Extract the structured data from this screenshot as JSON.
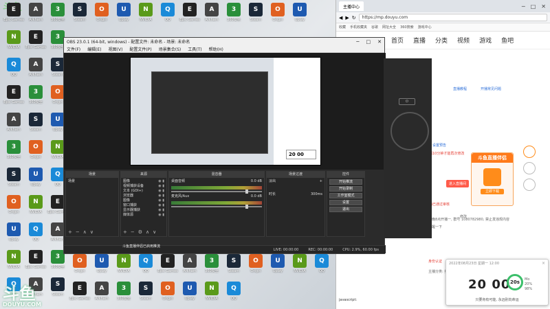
{
  "desktop": {
    "watermark": "斗鱼",
    "watermark_sub": "DOUYU.COM",
    "top_watermark": "斗鱼",
    "icons": [
      {
        "label": "Epic Games",
        "color": "#222",
        "glyph": "E"
      },
      {
        "label": "Arkham",
        "color": "#444",
        "glyph": "A"
      },
      {
        "label": "360安全",
        "color": "#2a8f3a",
        "glyph": "3"
      },
      {
        "label": "Steam",
        "color": "#1b2838",
        "glyph": "S"
      },
      {
        "label": "Origin",
        "color": "#e06020",
        "glyph": "O"
      },
      {
        "label": "Uplay",
        "color": "#1e5ab0",
        "glyph": "U"
      },
      {
        "label": "NVIDIA",
        "color": "#5a9a1a",
        "glyph": "N"
      },
      {
        "label": "QQ",
        "color": "#1a8ad8",
        "glyph": "Q"
      }
    ]
  },
  "obs": {
    "title": "OBS 23.0.1 (64-bit, windows) - 配置文件: 未命名 - 场景: 未命名",
    "menu": [
      "文件(F)",
      "编辑(E)",
      "视图(V)",
      "配置文件(P)",
      "场景集合(S)",
      "工具(T)",
      "帮助(H)"
    ],
    "docks": {
      "scenes": {
        "title": "场景",
        "items": [
          "场景"
        ]
      },
      "sources": {
        "title": "来源",
        "items": [
          "图像",
          "视频捕获设备",
          "文本 (GDI+)",
          "浏览器",
          "图像",
          "窗口捕获",
          "显示器捕获",
          "媒体源"
        ]
      },
      "mixer": {
        "title": "混音器",
        "tracks": [
          {
            "name": "桌面音频",
            "db": "0.0 dB"
          },
          {
            "name": "麦克风/Aux",
            "db": "0.0 dB"
          }
        ]
      },
      "transitions": {
        "title": "场景过渡",
        "type": "淡出",
        "duration_label": "时长",
        "duration_value": "300ms"
      },
      "controls": {
        "title": "控件",
        "buttons": [
          "开始推流",
          "开始录制",
          "工作室模式",
          "设置",
          "退出"
        ]
      }
    },
    "status": [
      "LIVE: 00:00:00",
      "REC: 00:00:00",
      "CPU: 2.9%, 60.00 fps"
    ],
    "notice": "斗鱼直播伴侣已启用推流"
  },
  "browser": {
    "tab_title": "主播中心",
    "url": "https://mp.douyu.com",
    "bookmarks": [
      "收藏",
      "手机收藏夹",
      "谷歌",
      "网址大全",
      "360搜索",
      "游戏中心"
    ],
    "nav": [
      "首页",
      "直播",
      "分类",
      "视频",
      "游戏",
      "鱼吧"
    ],
    "promo_title": "斗鱼直播伴侣",
    "promo_btn": "立即下载",
    "links": [
      "直播教程",
      "开播常见问题",
      "设置预告",
      "修改"
    ],
    "red_notes": [
      "需要间隔10分钟才能再次修改",
      "身份认证",
      "直播已通过审核"
    ],
    "grey_notes": [
      "每晚8点开播一, 群号 1080782980, 禁止发违规内容",
      "提醒一下",
      "主播分类: 英雄联盟"
    ],
    "orange_btn": "进入直播间",
    "bottom_input": "javascript:"
  },
  "timer": {
    "head": "2022年08月23日 星期一 12:00",
    "time": "20 00",
    "ring": "20s",
    "side": [
      "Mo",
      "20%",
      "98%"
    ],
    "foot": "只要肯有可能, 永远别向命运",
    "close": "×"
  }
}
